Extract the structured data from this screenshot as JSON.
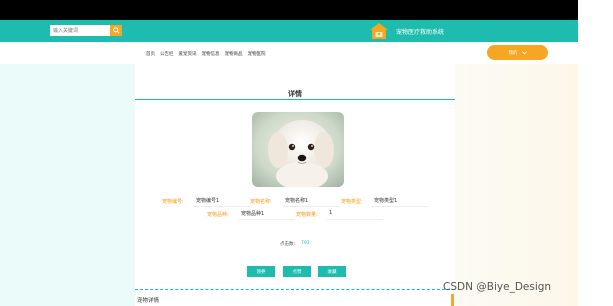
{
  "header": {
    "search_placeholder": "输入关键词",
    "site_title": "宠物医疗救助系统",
    "search_icon": "search-icon",
    "logo_icon": "house-logo"
  },
  "nav": {
    "links": [
      "首页",
      "公告栏",
      "爱宠资讯",
      "宠物信息",
      "宠物商品",
      "宠物医院"
    ],
    "user_label": "我的"
  },
  "detail": {
    "title": "详情",
    "fields": [
      {
        "label": "宠物编号:",
        "value": "宠物编号1"
      },
      {
        "label": "宠物名称:",
        "value": "宠物名称1"
      },
      {
        "label": "宠物类型:",
        "value": "宠物类型1"
      },
      {
        "label": "宠物品种:",
        "value": "宠物品种1"
      },
      {
        "label": "宠物数量:",
        "value": "1"
      }
    ],
    "clicks_label": "点击数:",
    "clicks_value": "793",
    "buttons": [
      "领养",
      "点赞",
      "收藏"
    ],
    "section_label": "宠物详情"
  },
  "watermark": "CSDN @Biye_Design",
  "colors": {
    "teal": "#1dbcae",
    "orange": "#f5a623",
    "label_orange": "#f39c12"
  }
}
